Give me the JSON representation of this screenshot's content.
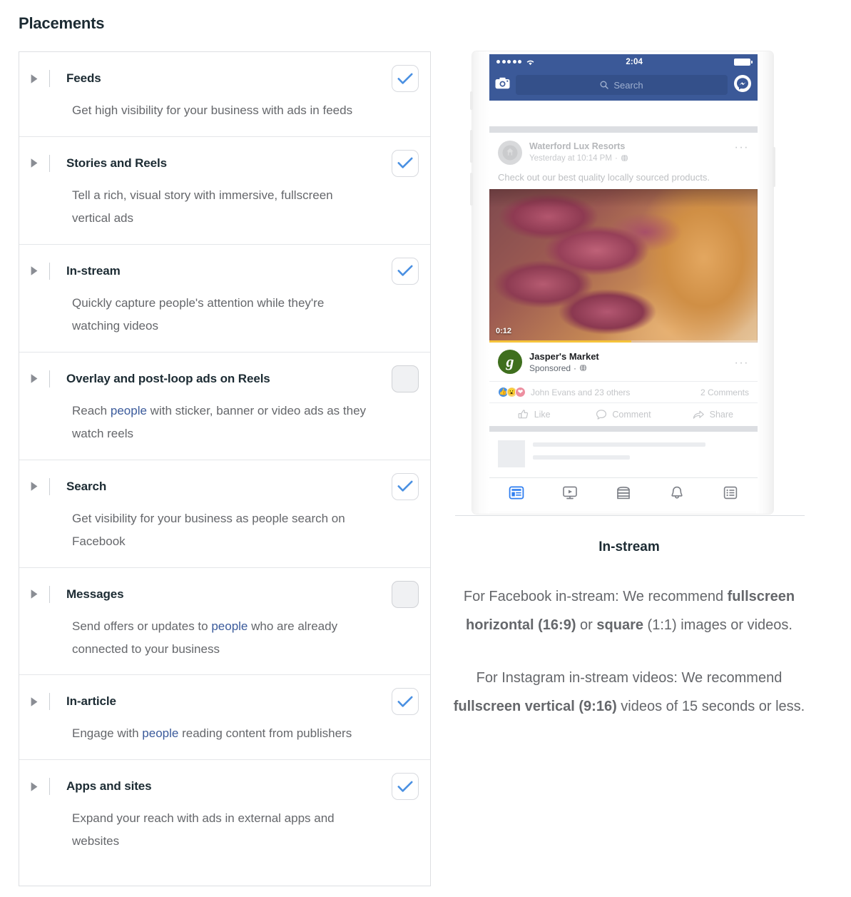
{
  "page_title": "Placements",
  "colors": {
    "accent_blue": "#4a90e2",
    "link_blue": "#3a5a9b",
    "fb_header": "#3b5998",
    "progress_yellow": "#f5c33b",
    "jaspers_green": "#3f6f1e"
  },
  "placements": [
    {
      "title": "Feeds",
      "desc_prefix": "Get high visibility for your business with ads in feeds",
      "link": "",
      "desc_suffix": "",
      "checked": true,
      "checkbox_state": "checked"
    },
    {
      "title": "Stories and Reels",
      "desc_prefix": "Tell a rich, visual story with immersive, fullscreen vertical ads",
      "link": "",
      "desc_suffix": "",
      "checked": true,
      "checkbox_state": "checked"
    },
    {
      "title": "In-stream",
      "desc_prefix": "Quickly capture people's attention while they're watching videos",
      "link": "",
      "desc_suffix": "",
      "checked": true,
      "checkbox_state": "checked"
    },
    {
      "title": "Overlay and post-loop ads on Reels",
      "desc_prefix": "Reach ",
      "link": "people",
      "desc_suffix": " with sticker, banner or video ads as they watch reels",
      "checked": false,
      "checkbox_state": "unchecked"
    },
    {
      "title": "Search",
      "desc_prefix": "Get visibility for your business as people search on Facebook",
      "link": "",
      "desc_suffix": "",
      "checked": true,
      "checkbox_state": "checked"
    },
    {
      "title": "Messages",
      "desc_prefix": "Send offers or updates to ",
      "link": "people",
      "desc_suffix": " who are already connected to your business",
      "checked": false,
      "checkbox_state": "unchecked"
    },
    {
      "title": "In-article",
      "desc_prefix": "Engage with ",
      "link": "people",
      "desc_suffix": " reading content from publishers",
      "checked": true,
      "checkbox_state": "checked"
    },
    {
      "title": "Apps and sites",
      "desc_prefix": "Expand your reach with ads in external apps and websites",
      "link": "",
      "desc_suffix": "",
      "checked": true,
      "checkbox_state": "checked"
    }
  ],
  "phone_preview": {
    "status_bar": {
      "time": "2:04"
    },
    "header": {
      "search_placeholder": "Search"
    },
    "post": {
      "page_name": "Waterford Lux Resorts",
      "timestamp": "Yesterday at 10:14 PM",
      "privacy": "globe",
      "separator": "·",
      "body_text": "Check out our best quality locally sourced products.",
      "more_options": "···",
      "video_duration": "0:12"
    },
    "sponsored": {
      "page_name": "Jasper's Market",
      "label": "Sponsored",
      "separator": "·",
      "avatar_letter": "g",
      "more_options": "···"
    },
    "engagement": {
      "reactions_text": "John Evans and 23 others",
      "comments_text": "2 Comments"
    },
    "actions": [
      {
        "label": "Like",
        "icon": "thumbs-up-icon"
      },
      {
        "label": "Comment",
        "icon": "comment-bubble-icon"
      },
      {
        "label": "Share",
        "icon": "share-arrow-icon"
      }
    ],
    "tabbar": [
      {
        "icon": "news-feed-icon",
        "active": true
      },
      {
        "icon": "watch-video-icon",
        "active": false
      },
      {
        "icon": "marketplace-icon",
        "active": false
      },
      {
        "icon": "notifications-bell-icon",
        "active": false
      },
      {
        "icon": "menu-list-icon",
        "active": false
      }
    ]
  },
  "preview_caption": {
    "title": "In-stream",
    "paragraph1": {
      "part1": "For Facebook in-stream: We recommend ",
      "bold1": "fullscreen horizontal (16:9)",
      "part2": " or ",
      "bold2": "square",
      "part3": " (1:1) images or videos."
    },
    "paragraph2": {
      "part1": "For Instagram in-stream videos: We recommend ",
      "bold1": "fullscreen vertical (9:16)",
      "part2": " videos of 15 seconds or less."
    }
  }
}
